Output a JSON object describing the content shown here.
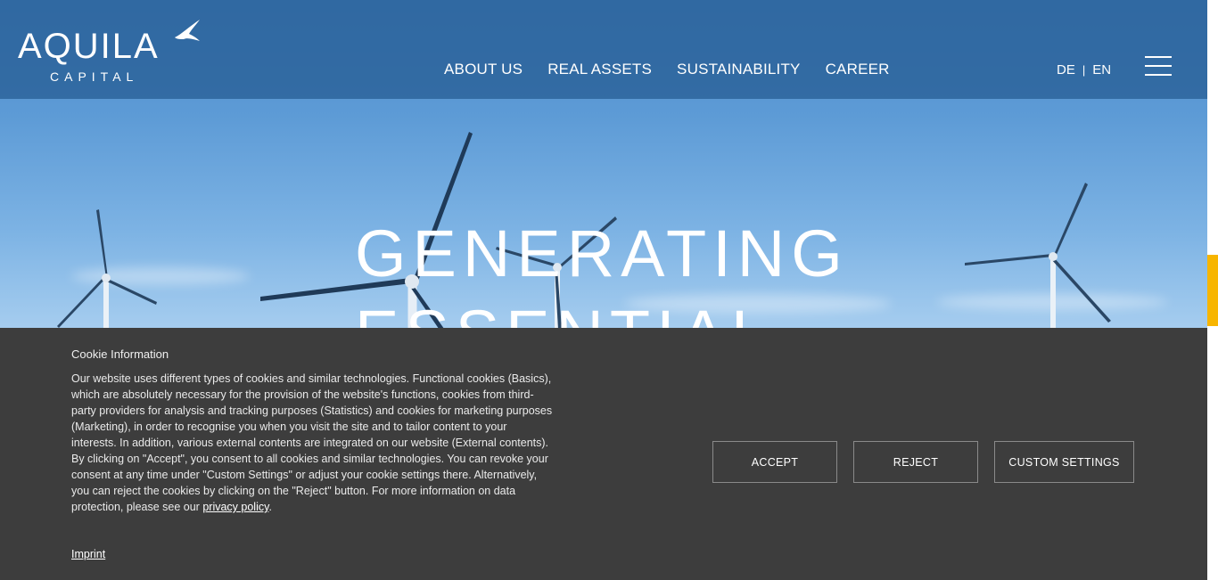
{
  "brand": {
    "name": "AQUILA",
    "subtitle": "CAPITAL"
  },
  "nav": {
    "items": [
      "ABOUT US",
      "REAL ASSETS",
      "SUSTAINABILITY",
      "CAREER"
    ]
  },
  "language": {
    "de": "DE",
    "separator": "|",
    "en": "EN"
  },
  "hero": {
    "headline_line1": "GENERATING",
    "headline_line2": "ESSENTIAL"
  },
  "cookie": {
    "title": "Cookie Information",
    "body": "Our website uses different types of cookies and similar technologies. Functional cookies (Basics), which are absolutely necessary for the provision of the website's functions, cookies from third-party providers for analysis and tracking purposes (Statistics) and cookies for marketing purposes (Marketing), in order to recognise you when you visit the site and to tailor content to your interests. In addition, various external contents are integrated on our website (External contents). By clicking on \"Accept\", you consent to all cookies and similar technologies. You can revoke your consent at any time under \"Custom Settings\" or adjust your cookie settings there. Alternatively, you can reject the cookies by clicking on the \"Reject\" button. For more information on data protection, please see our",
    "privacy_link": "privacy policy",
    "privacy_suffix": ".",
    "imprint": "Imprint",
    "accept_label": "ACCEPT",
    "reject_label": "REJECT",
    "custom_label": "CUSTOM SETTINGS"
  },
  "colors": {
    "header_bg": "#2c5f96",
    "cookie_bg": "#3d3d3d",
    "accent_tab": "#f7b500"
  }
}
